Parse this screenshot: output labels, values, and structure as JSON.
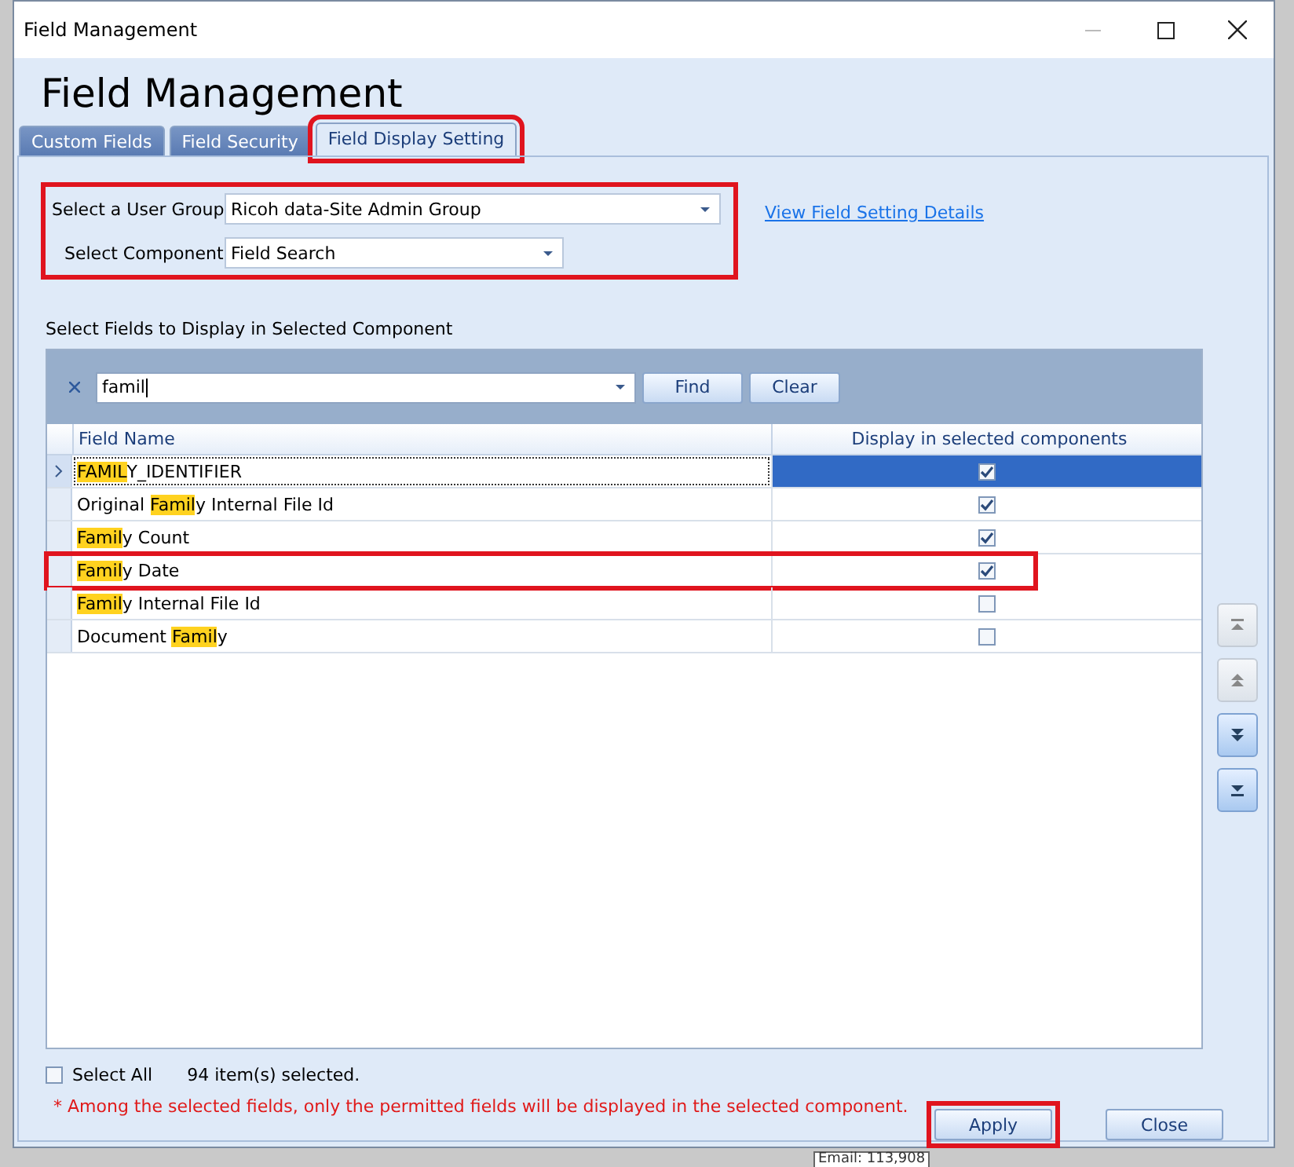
{
  "window": {
    "title": "Field Management",
    "heading": "Field Management"
  },
  "tabs": [
    {
      "label": "Custom Fields",
      "selected": false,
      "outlined": false
    },
    {
      "label": "Field Security",
      "selected": false,
      "outlined": false
    },
    {
      "label": "Field Display Setting",
      "selected": true,
      "outlined": true
    }
  ],
  "selectors": {
    "outlined": true,
    "user_group": {
      "label": "Select a User Group",
      "value": "Ricoh data-Site Admin Group"
    },
    "component": {
      "label": "Select Component",
      "value": "Field Search"
    }
  },
  "details_link": "View Field Setting Details",
  "fields_label": "Select Fields to Display in Selected Component",
  "search": {
    "value": "famil",
    "find": "Find",
    "clear": "Clear"
  },
  "table": {
    "columns": [
      "Field Name",
      "Display in selected components"
    ],
    "rows": [
      {
        "before": "",
        "match": "FAMIL",
        "after": "Y_IDENTIFIER",
        "checked": true,
        "selected": true,
        "outlined": false
      },
      {
        "before": "Original ",
        "match": "Famil",
        "after": "y Internal File Id",
        "checked": true,
        "selected": false,
        "outlined": false
      },
      {
        "before": "",
        "match": "Famil",
        "after": "y Count",
        "checked": true,
        "selected": false,
        "outlined": false
      },
      {
        "before": "",
        "match": "Famil",
        "after": "y Date",
        "checked": true,
        "selected": false,
        "outlined": true
      },
      {
        "before": "",
        "match": "Famil",
        "after": "y Internal File Id",
        "checked": false,
        "selected": false,
        "outlined": false
      },
      {
        "before": "Document ",
        "match": "Famil",
        "after": "y",
        "checked": false,
        "selected": false,
        "outlined": false
      }
    ]
  },
  "move_buttons": [
    {
      "kind": "top",
      "disabled": true
    },
    {
      "kind": "up",
      "disabled": true
    },
    {
      "kind": "down",
      "disabled": false
    },
    {
      "kind": "bottom",
      "disabled": false
    }
  ],
  "select_all": {
    "label": "Select All",
    "checked": false
  },
  "selected_count": "94 item(s) selected.",
  "note": "* Among the selected fields, only the permitted fields will be displayed in the selected component.",
  "buttons": [
    {
      "label": "Apply",
      "outlined": true
    },
    {
      "label": "Close",
      "outlined": false
    }
  ],
  "background_text": "Email: 113,908"
}
